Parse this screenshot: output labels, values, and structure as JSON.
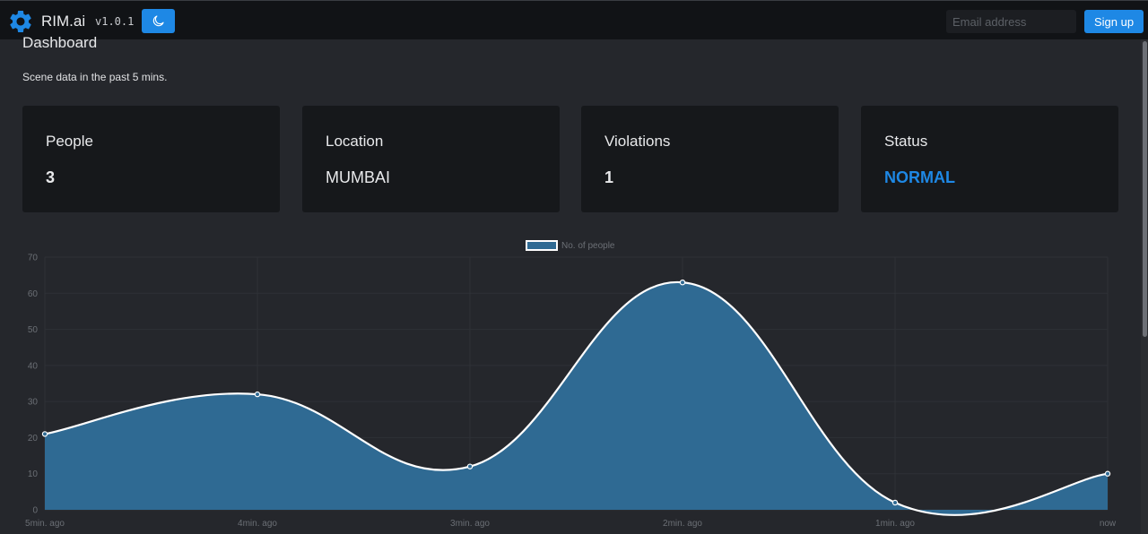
{
  "app": {
    "name": "RIM.ai",
    "version": "v1.0.1"
  },
  "nav": {
    "theme_toggle_icon": "moon-icon",
    "email_placeholder": "Email address",
    "signup_label": "Sign up",
    "accent_color": "#1e88e5"
  },
  "page": {
    "title": "Dashboard",
    "subtitle": "Scene data in the past 5 mins."
  },
  "cards": [
    {
      "label": "People",
      "value": "3"
    },
    {
      "label": "Location",
      "value": "MUMBAI"
    },
    {
      "label": "Violations",
      "value": "1"
    },
    {
      "label": "Status",
      "value": "NORMAL",
      "value_color": "#1e88e5"
    }
  ],
  "chart_data": {
    "type": "area",
    "categories": [
      "5min. ago",
      "4min. ago",
      "3min. ago",
      "2min. ago",
      "1min. ago",
      "now"
    ],
    "series": [
      {
        "name": "No. of people",
        "values": [
          21,
          32,
          12,
          63,
          2,
          10
        ]
      }
    ],
    "ylim": [
      0,
      70
    ],
    "yticks": [
      0,
      10,
      20,
      30,
      40,
      50,
      60,
      70
    ],
    "grid": true,
    "legend": "top-center",
    "fill_color": "#2f6a93",
    "line_color": "#ffffff"
  }
}
